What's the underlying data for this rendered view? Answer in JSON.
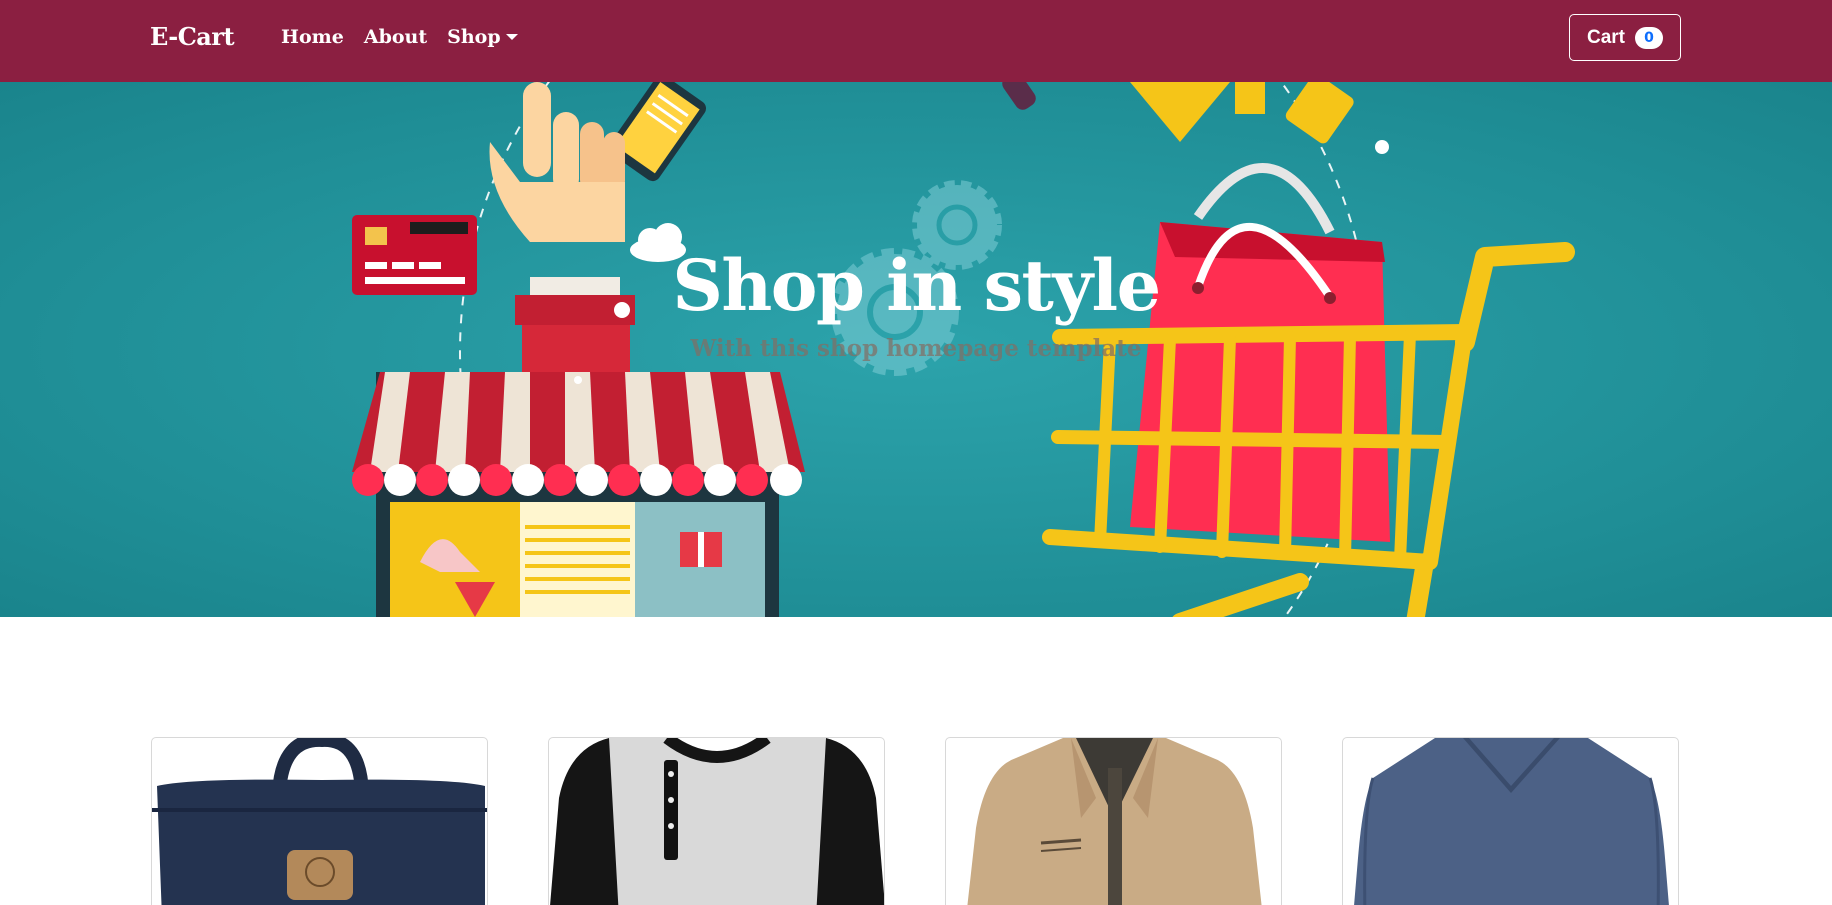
{
  "navbar": {
    "brand": "E-Cart",
    "links": [
      "Home",
      "About",
      "Shop"
    ],
    "cart_label": "Cart",
    "cart_count": "0",
    "color": "#8b1f41"
  },
  "hero": {
    "title": "Shop in style",
    "subtitle": "With this shop homepage template",
    "background_color": "#2ca3ab"
  },
  "products": [
    {
      "image": "navy-backpack"
    },
    {
      "image": "raglan-henley-shirt"
    },
    {
      "image": "beige-jacket"
    },
    {
      "image": "blue-v-neck-sweater"
    }
  ]
}
